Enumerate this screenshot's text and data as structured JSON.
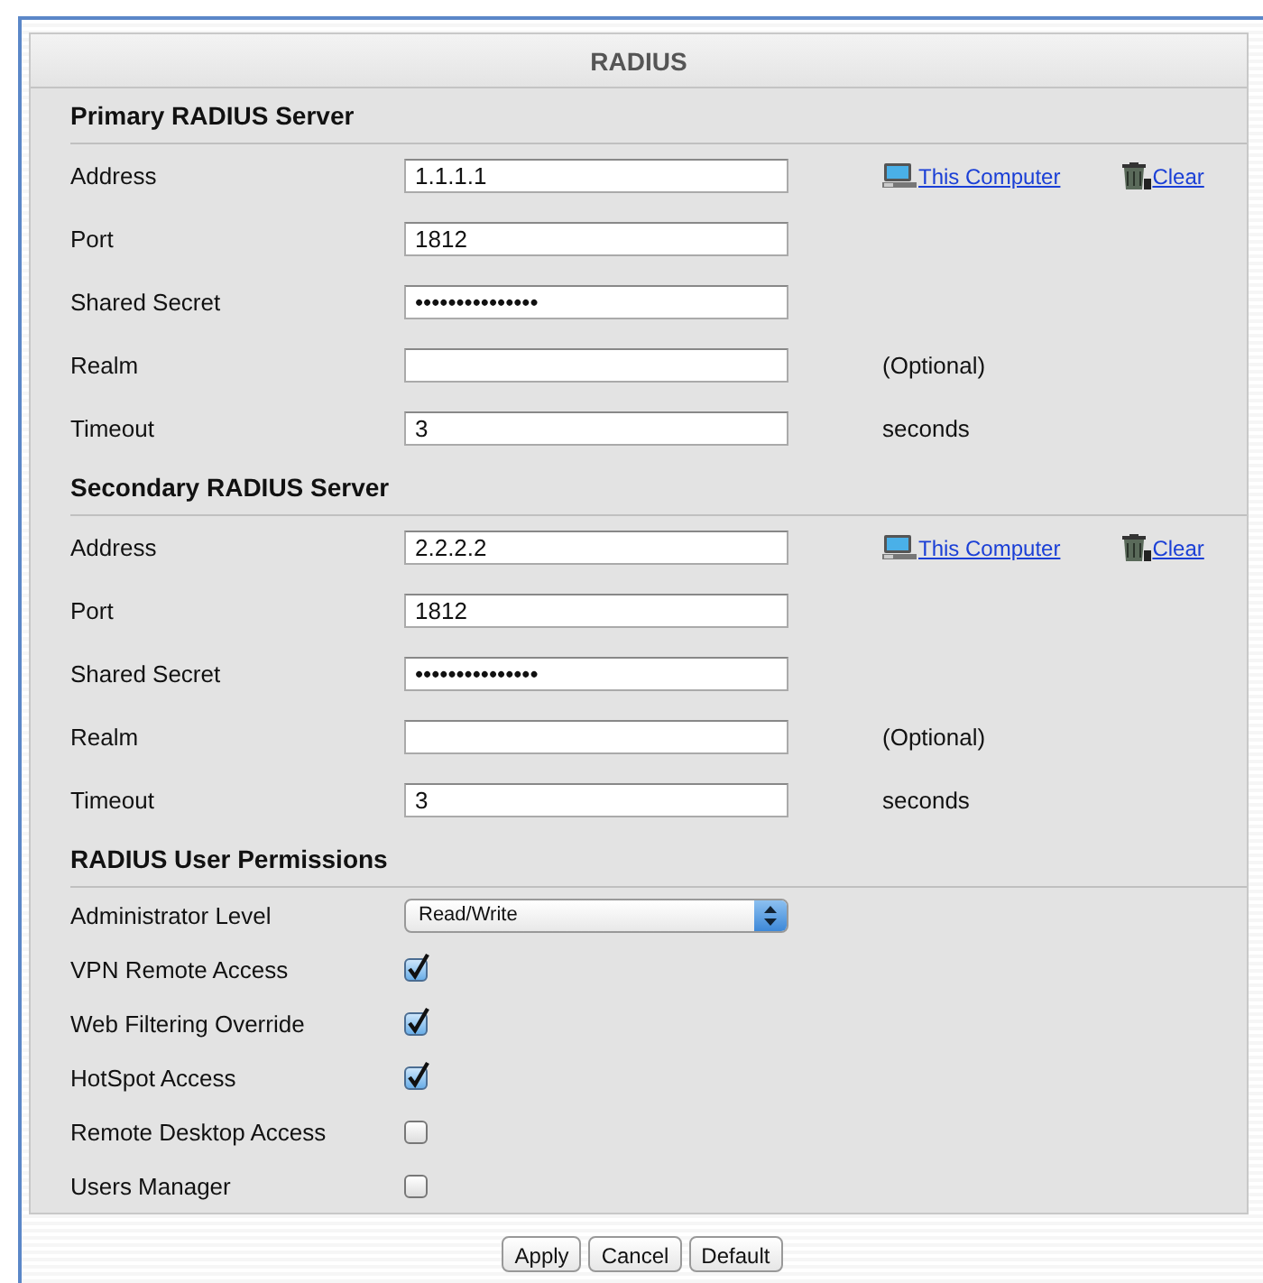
{
  "title": "RADIUS",
  "sections": [
    {
      "heading": "Primary RADIUS Server",
      "rows": [
        {
          "kind": "text",
          "label": "Address",
          "value": "1.1.1.1",
          "links": [
            {
              "kind": "computer",
              "text": "This Computer"
            },
            {
              "kind": "trash",
              "text": "Clear"
            }
          ]
        },
        {
          "kind": "text",
          "label": "Port",
          "value": "1812"
        },
        {
          "kind": "password",
          "label": "Shared Secret",
          "value": "•••••••••••••••"
        },
        {
          "kind": "text",
          "label": "Realm",
          "note": "(Optional)"
        },
        {
          "kind": "text",
          "label": "Timeout",
          "value": "3",
          "note": "seconds"
        }
      ]
    },
    {
      "heading": "Secondary RADIUS Server",
      "rows": [
        {
          "kind": "text",
          "label": "Address",
          "value": "2.2.2.2",
          "links": [
            {
              "kind": "computer",
              "text": "This Computer"
            },
            {
              "kind": "trash",
              "text": "Clear"
            }
          ]
        },
        {
          "kind": "text",
          "label": "Port",
          "value": "1812"
        },
        {
          "kind": "password",
          "label": "Shared Secret",
          "value": "•••••••••••••••"
        },
        {
          "kind": "text",
          "label": "Realm",
          "note": "(Optional)"
        },
        {
          "kind": "text",
          "label": "Timeout",
          "value": "3",
          "note": "seconds"
        }
      ]
    },
    {
      "heading": "RADIUS User Permissions",
      "rows": [
        {
          "kind": "select",
          "label": "Administrator Level",
          "value": "Read/Write"
        },
        {
          "kind": "checkbox",
          "label": "VPN Remote Access",
          "checked": true
        },
        {
          "kind": "checkbox",
          "label": "Web Filtering Override",
          "checked": true
        },
        {
          "kind": "checkbox",
          "label": "HotSpot Access",
          "checked": true
        },
        {
          "kind": "checkbox",
          "label": "Remote Desktop Access",
          "checked": false
        },
        {
          "kind": "checkbox",
          "label": "Users Manager",
          "checked": false
        }
      ]
    }
  ],
  "buttons": [
    "Apply",
    "Cancel",
    "Default"
  ]
}
